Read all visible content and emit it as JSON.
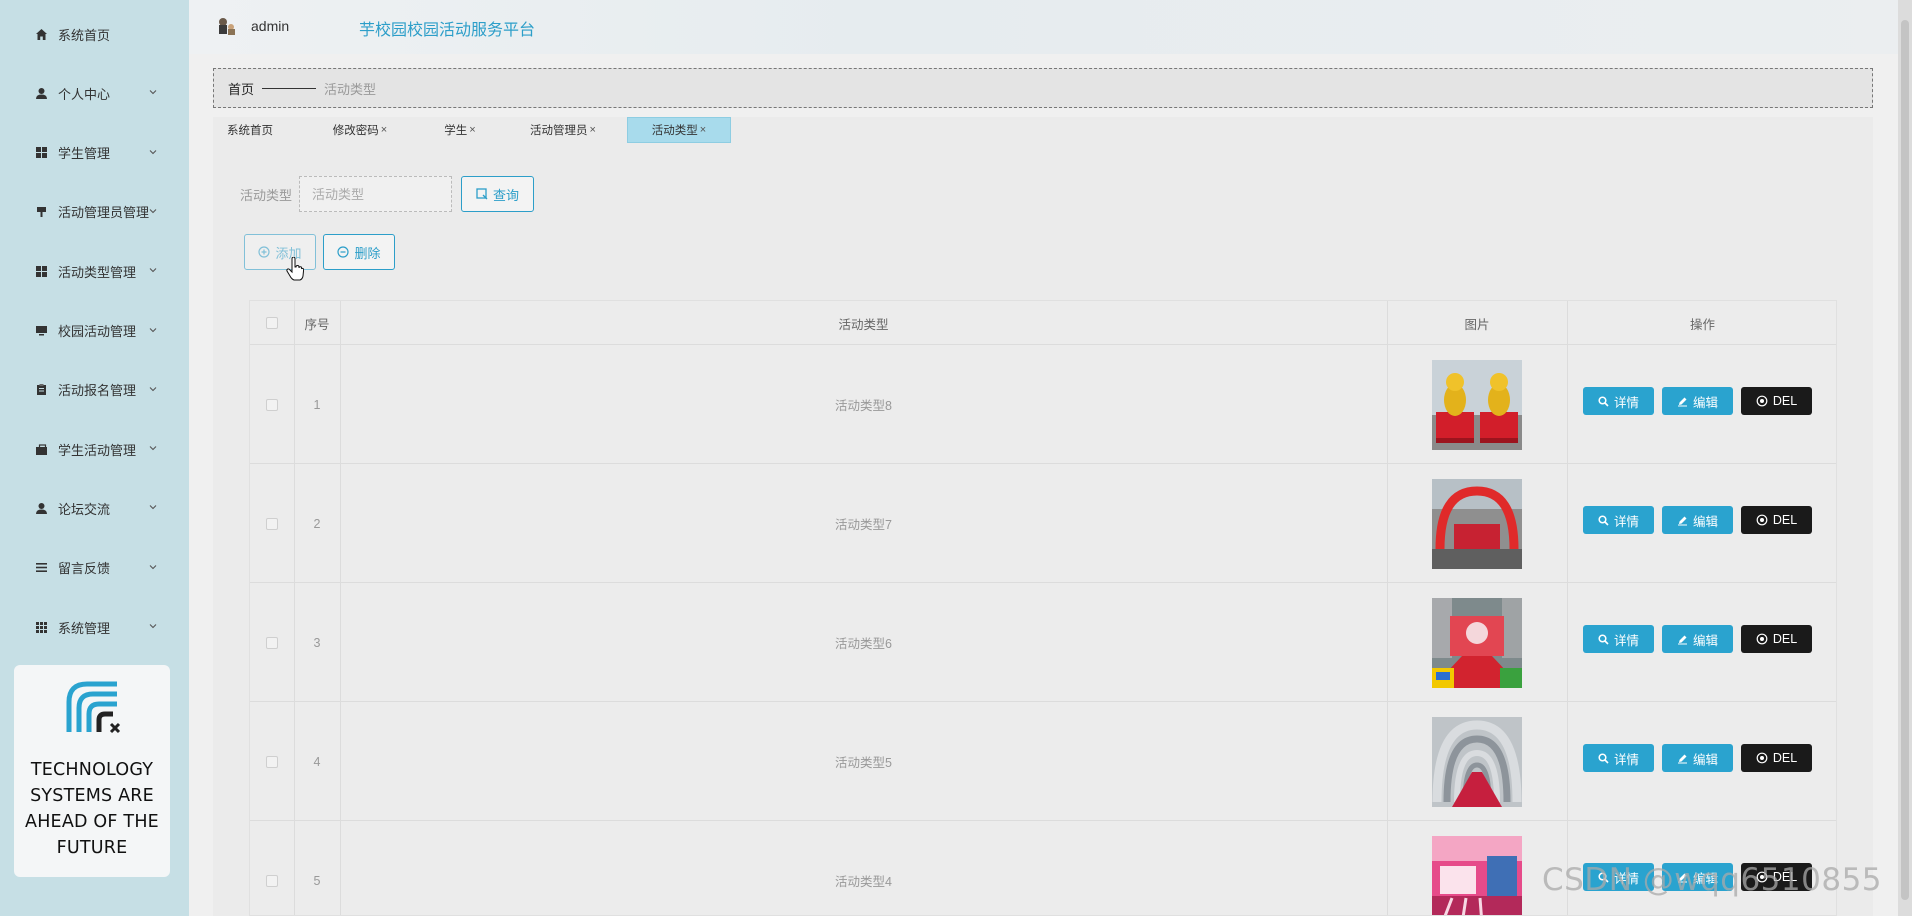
{
  "header": {
    "username": "admin",
    "title": "芋校园校园活动服务平台"
  },
  "sidebar": {
    "items": [
      {
        "label": "系统首页",
        "icon": "home-icon",
        "has_chevron": false
      },
      {
        "label": "个人中心",
        "icon": "user-icon",
        "has_chevron": true
      },
      {
        "label": "学生管理",
        "icon": "grid-icon",
        "has_chevron": true
      },
      {
        "label": "活动管理员管理",
        "icon": "pin-icon",
        "has_chevron": true
      },
      {
        "label": "活动类型管理",
        "icon": "grid-icon",
        "has_chevron": true
      },
      {
        "label": "校园活动管理",
        "icon": "monitor-icon",
        "has_chevron": true
      },
      {
        "label": "活动报名管理",
        "icon": "clipboard-icon",
        "has_chevron": true
      },
      {
        "label": "学生活动管理",
        "icon": "briefcase-icon",
        "has_chevron": true
      },
      {
        "label": "论坛交流",
        "icon": "user-icon",
        "has_chevron": true
      },
      {
        "label": "留言反馈",
        "icon": "list-icon",
        "has_chevron": true
      },
      {
        "label": "系统管理",
        "icon": "apps-icon",
        "has_chevron": true
      }
    ],
    "promo_text": "TECHNOLOGY SYSTEMS ARE AHEAD OF THE FUTURE"
  },
  "breadcrumb": {
    "home": "首页",
    "current": "活动类型"
  },
  "tabs": [
    {
      "label": "系统首页",
      "closable": false,
      "active": false
    },
    {
      "label": "修改密码",
      "closable": true,
      "active": false
    },
    {
      "label": "学生",
      "closable": true,
      "active": false
    },
    {
      "label": "活动管理员",
      "closable": true,
      "active": false
    },
    {
      "label": "活动类型",
      "closable": true,
      "active": true
    }
  ],
  "search": {
    "label": "活动类型",
    "placeholder": "活动类型",
    "button": "查询"
  },
  "toolbar": {
    "add": "添加",
    "delete": "删除"
  },
  "table": {
    "headers": [
      "序号",
      "活动类型",
      "图片",
      "操作"
    ],
    "rows": [
      {
        "index": "1",
        "type": "活动类型8",
        "image": "golden-lions-photo"
      },
      {
        "index": "2",
        "type": "活动类型7",
        "image": "red-arch-photo"
      },
      {
        "index": "3",
        "type": "活动类型6",
        "image": "stage-carpet-photo"
      },
      {
        "index": "4",
        "type": "活动类型5",
        "image": "balloon-tunnel-photo"
      },
      {
        "index": "5",
        "type": "活动类型4",
        "image": "pink-hall-photo"
      }
    ],
    "actions": {
      "detail": "详情",
      "edit": "编辑",
      "del": "DEL"
    }
  },
  "watermark": "CSDN @wqq6510855",
  "colors": {
    "sidebar_bg": "#c6dfe5",
    "accent": "#2aa3cf",
    "active_tab": "#a8dbec",
    "del_button": "#1a1a1a"
  }
}
